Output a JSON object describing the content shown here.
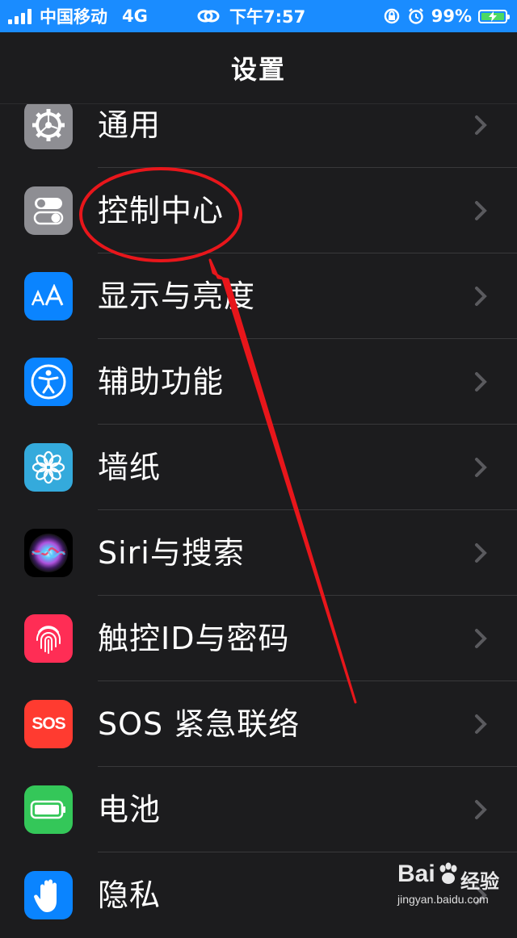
{
  "status_bar": {
    "carrier": "中国移动",
    "network": "4G",
    "time": "下午7:57",
    "battery_percent": "99%",
    "battery_level": 0.99
  },
  "nav": {
    "title": "设置"
  },
  "settings": [
    {
      "label": "通用",
      "icon": "gear-icon",
      "color": "#8e8e93"
    },
    {
      "label": "控制中心",
      "icon": "toggles-icon",
      "color": "#8e8e93"
    },
    {
      "label": "显示与亮度",
      "icon": "text-size-icon",
      "color": "#0a84ff"
    },
    {
      "label": "辅助功能",
      "icon": "accessibility-icon",
      "color": "#0a84ff"
    },
    {
      "label": "墙纸",
      "icon": "flower-icon",
      "color": "#34aadc"
    },
    {
      "label": "Siri与搜索",
      "icon": "siri-icon",
      "color": "#000000"
    },
    {
      "label": "触控ID与密码",
      "icon": "fingerprint-icon",
      "color": "#ff2d55"
    },
    {
      "label": "SOS 紧急联络",
      "icon": "sos-icon",
      "color": "#ff3b30",
      "icon_text": "SOS"
    },
    {
      "label": "电池",
      "icon": "battery-icon",
      "color": "#34c759"
    },
    {
      "label": "隐私",
      "icon": "hand-icon",
      "color": "#0a84ff"
    }
  ],
  "annotation": {
    "color": "#e8161b",
    "highlight": "控制中心"
  },
  "watermark": {
    "brand": "Bai",
    "brand_suffix": "经验",
    "url": "jingyan.baidu.com"
  }
}
